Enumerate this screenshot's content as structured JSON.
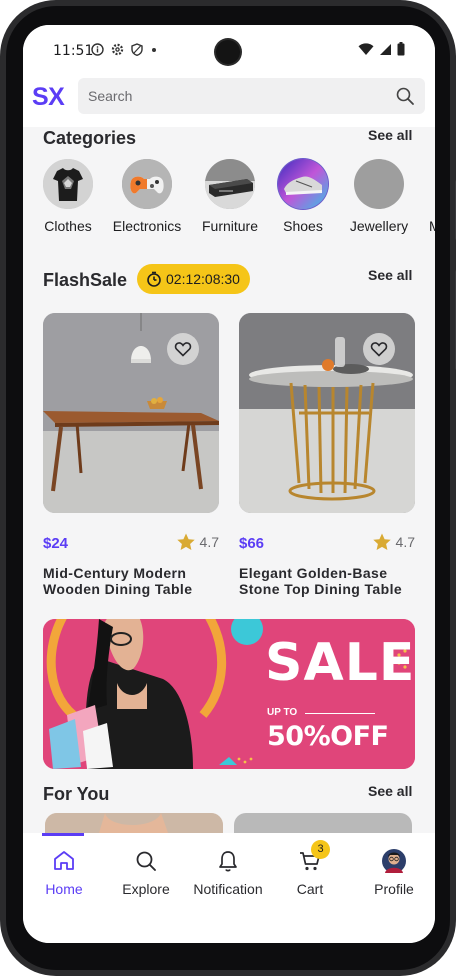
{
  "status_bar": {
    "time": "11:51"
  },
  "header": {
    "logo": "SX",
    "search_placeholder": "Search"
  },
  "categories": {
    "title": "Categories",
    "see_all": "See all",
    "items": [
      {
        "label": "Clothes",
        "icon": "tshirt-image"
      },
      {
        "label": "Electronics",
        "icon": "game-controller-image"
      },
      {
        "label": "Furniture",
        "icon": "media-player-image"
      },
      {
        "label": "Shoes",
        "icon": "sneaker-image"
      },
      {
        "label": "Jewellery",
        "icon": "placeholder-image"
      },
      {
        "label": "M",
        "icon": "placeholder-image"
      }
    ]
  },
  "flash_sale": {
    "title": "FlashSale",
    "timer": "02:12:08:30",
    "see_all": "See all",
    "products": [
      {
        "price": "$24",
        "rating": "4.7",
        "name": "Mid-Century Modern Wooden Dining Table"
      },
      {
        "price": "$66",
        "rating": "4.7",
        "name": "Elegant Golden-Base Stone Top Dining Table"
      }
    ]
  },
  "banner": {
    "headline": "SALE",
    "upto": "UP TO",
    "discount": "50%OFF"
  },
  "for_you": {
    "title": "For You",
    "see_all": "See all"
  },
  "bottom_nav": {
    "items": [
      {
        "label": "Home",
        "icon": "home-icon",
        "active": true
      },
      {
        "label": "Explore",
        "icon": "search-icon"
      },
      {
        "label": "Notification",
        "icon": "bell-icon"
      },
      {
        "label": "Cart",
        "icon": "cart-icon",
        "badge": "3"
      },
      {
        "label": "Profile",
        "icon": "avatar"
      }
    ]
  },
  "colors": {
    "accent": "#5b3df5",
    "highlight": "#f5c518",
    "banner": "#e0457a"
  }
}
